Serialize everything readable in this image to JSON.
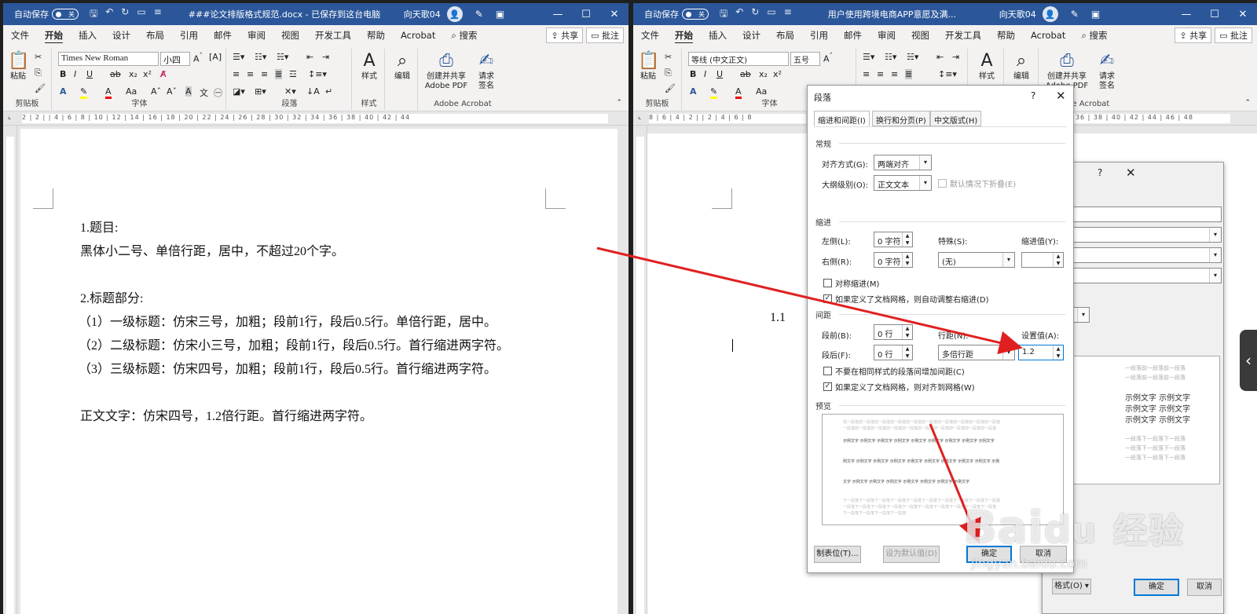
{
  "left": {
    "autosave": "自动保存",
    "autosave_state": "关",
    "title": "###论文排版格式规范.docx - 已保存到这台电脑",
    "user": "向天歌04",
    "tabs": [
      "文件",
      "开始",
      "插入",
      "设计",
      "布局",
      "引用",
      "邮件",
      "审阅",
      "视图",
      "开发工具",
      "帮助",
      "Acrobat"
    ],
    "search": "搜索",
    "share": "共享",
    "comment": "批注",
    "font_name": "Times New Roman",
    "font_size": "小四",
    "groups": {
      "clipboard": "剪贴板",
      "font": "字体",
      "paragraph": "段落",
      "styles": "样式",
      "acrobat": "Adobe Acrobat"
    },
    "paste": "粘贴",
    "styles_btn": "样式",
    "edit_btn": "编辑",
    "create_pdf": "创建并共享\nAdobe PDF",
    "request_sign": "请求\n签名",
    "ruler": "2 | 2 | | 4 | 6 | 8 | 10 | 12 | 14 | 16 | 18 | 20 | 22 | 24 | 26 | 28 | 30 | 32 | 34 | 36 | 38 | 40 | 42 | 44",
    "doc_lines": [
      "1.题目:",
      "黑体小二号、单倍行距，居中，不超过20个字。",
      "",
      "2.标题部分:",
      "（1）一级标题：仿宋三号，加粗；段前1行，段后0.5行。单倍行距，居中。",
      "（2）二级标题：仿宋小三号，加粗；段前1行，段后0.5行。首行缩进两字符。",
      "（3）三级标题：仿宋四号，加粗；段前1行，段后0.5行。首行缩进两字符。",
      "",
      "正文文字：仿宋四号，1.2倍行距。首行缩进两字符。"
    ]
  },
  "right": {
    "autosave": "自动保存",
    "autosave_state": "关",
    "title": "用户使用跨境电商APP意愿及满...",
    "user": "向天歌04",
    "tabs": [
      "文件",
      "开始",
      "插入",
      "设计",
      "布局",
      "引用",
      "邮件",
      "审阅",
      "视图",
      "开发工具",
      "帮助",
      "Acrobat"
    ],
    "search": "搜索",
    "share": "共享",
    "comment": "批注",
    "font_name": "等线 (中文正文)",
    "font_size": "五号",
    "groups": {
      "clipboard": "剪贴板",
      "font": "字体",
      "acrobat": "dobe Acrobat"
    },
    "paste": "粘贴",
    "styles_btn": "样式",
    "edit_btn": "编辑",
    "create_pdf": "创建并共享\nAdobe PDF",
    "request_sign": "请求\n签名",
    "ruler": "8 | 6 | 4 | 2 | | 2 | 4 | 6 | 8",
    "ruler_right": "34 | 36 | 38 | 40 | 42 | 44 | 46 | 48",
    "doc_partial": [
      "1.1"
    ],
    "bg_dialog": {
      "preview_text": [
        "一段落前一段落前一段落",
        "一段落前一段落前一段落",
        "示例文字 示例文字",
        "示例文字 示例文字",
        "示例文字 示例文字",
        "一段落下一段落下一段落",
        "一段落下一段落下一段落",
        "一段落下一段落下一段落"
      ],
      "format_btn": "格式(O) ▾",
      "ok": "确定",
      "cancel": "取消"
    }
  },
  "dialog": {
    "title": "段落",
    "help": "?",
    "tabs": [
      "缩进和间距(I)",
      "换行和分页(P)",
      "中文版式(H)"
    ],
    "general": "常规",
    "alignment_label": "对齐方式(G):",
    "alignment_value": "两端对齐",
    "outline_label": "大纲级别(O):",
    "outline_value": "正文文本",
    "collapse_label": "默认情况下折叠(E)",
    "indent": "缩进",
    "left_label": "左侧(L):",
    "left_value": "0 字符",
    "right_label": "右侧(R):",
    "right_value": "0 字符",
    "special_label": "特殊(S):",
    "special_value": "(无)",
    "indent_value_label": "缩进值(Y):",
    "indent_value": "",
    "mirror_label": "对称缩进(M)",
    "auto_right_label": "如果定义了文档网格，则自动调整右缩进(D)",
    "spacing": "间距",
    "before_label": "段前(B):",
    "before_value": "0 行",
    "after_label": "段后(F):",
    "after_value": "0 行",
    "line_label": "行距(N):",
    "line_value": "多倍行距",
    "set_label": "设置值(A):",
    "set_value": "1.2",
    "no_space_label": "不要在相同样式的段落间增加间距(C)",
    "snap_grid_label": "如果定义了文档网格，则对齐到网格(W)",
    "preview": "预览",
    "preview_lines": [
      "前一段落前一段落前一段落前一段落前一段落前一段落前一段落前一段落前一段落前一段落",
      "一段落前一段落前一段落前一段落前一段落前一段落前一段落前一段落前一段落前一段落",
      "示例文字 示例文字 示例文字 示例文字 示例文字 示例文字 示例文字 示例文字 示例文字",
      "例文字 示例文字 示例文字 示例文字 示例文字 示例文字 示例文字 示例文字 示例文字 示例",
      "文字 示例文字 示例文字 示例文字 示例文字 示例文字 示例文字 示例文字",
      "下一段落下一段落下一段落下一段落下一段落下一段落下一段落下一段落下一段落下一段落",
      "一段落下一段落下一段落下一段落下一段落下一段落下一段落下一段落下一段落下一段落",
      "下一段落下一段落下一段落下一段落"
    ],
    "tabs_btn": "制表位(T)...",
    "default_btn": "设为默认值(D)",
    "ok": "确定",
    "cancel": "取消"
  },
  "watermark": {
    "brand": "Bai",
    "brand2": "经验",
    "url": "jingyan.baidu.com"
  },
  "colors": {
    "title_bar": "#2b579a",
    "arrow": "#e02020",
    "ok_border": "#0078d7"
  }
}
